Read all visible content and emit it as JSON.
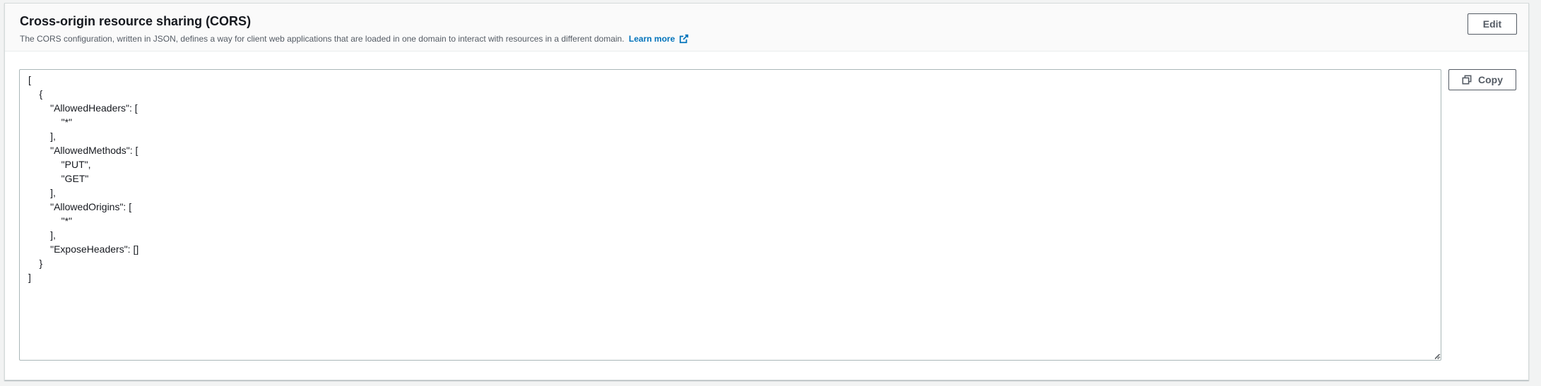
{
  "panel": {
    "title": "Cross-origin resource sharing (CORS)",
    "description": "The CORS configuration, written in JSON, defines a way for client web applications that are loaded in one domain to interact with resources in a different domain.",
    "learn_more_label": "Learn more",
    "learn_more_icon": "external-link-icon",
    "edit_label": "Edit"
  },
  "editor": {
    "copy_label": "Copy",
    "copy_icon": "copy-icon",
    "content": "[\n    {\n        \"AllowedHeaders\": [\n            \"*\"\n        ],\n        \"AllowedMethods\": [\n            \"PUT\",\n            \"GET\"\n        ],\n        \"AllowedOrigins\": [\n            \"*\"\n        ],\n        \"ExposeHeaders\": []\n    }\n]"
  },
  "colors": {
    "link": "#0073bb",
    "button_text": "#545b64",
    "page_bg": "#f2f3f3",
    "border": "#aab7b8"
  }
}
